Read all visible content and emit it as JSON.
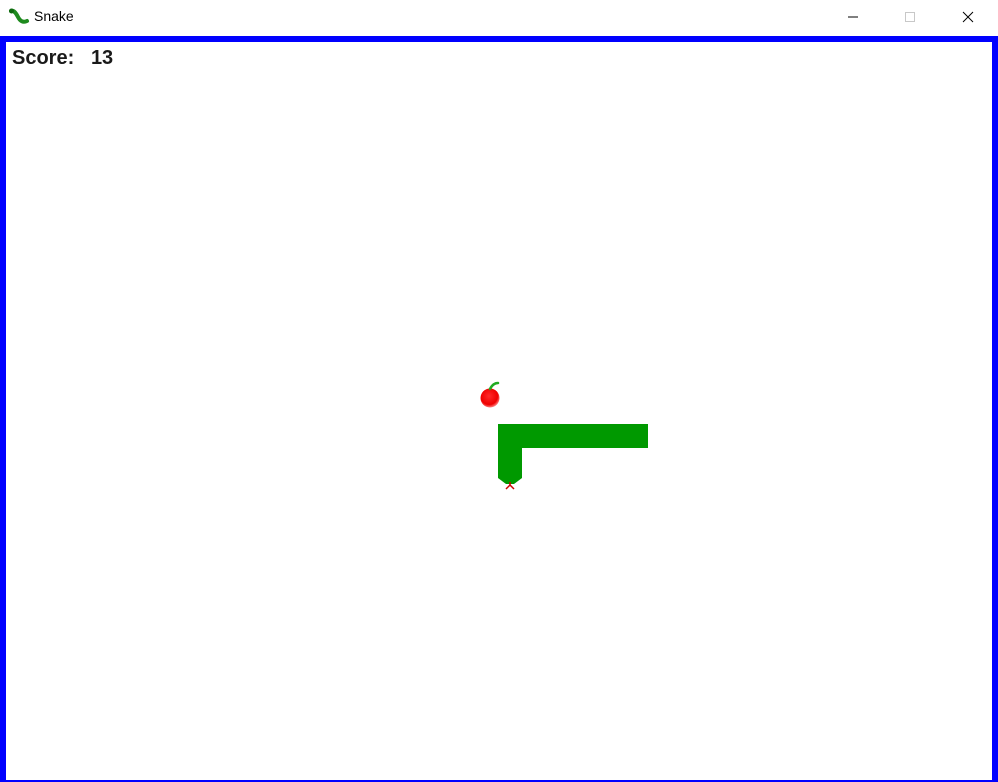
{
  "window": {
    "title": "Snake",
    "app_icon": "snake-icon",
    "controls": {
      "minimize_icon": "minimize-icon",
      "maximize_icon": "maximize-icon",
      "close_icon": "close-icon"
    }
  },
  "game": {
    "score_label": "Score:",
    "score_value": "13",
    "border_color": "#0000ff",
    "background_color": "#ffffff",
    "snake_color": "#009900",
    "apple_color": "#ff0000",
    "apple_leaf_color": "#22aa22",
    "tongue_color": "#cc0000",
    "snake_heading": "down"
  }
}
